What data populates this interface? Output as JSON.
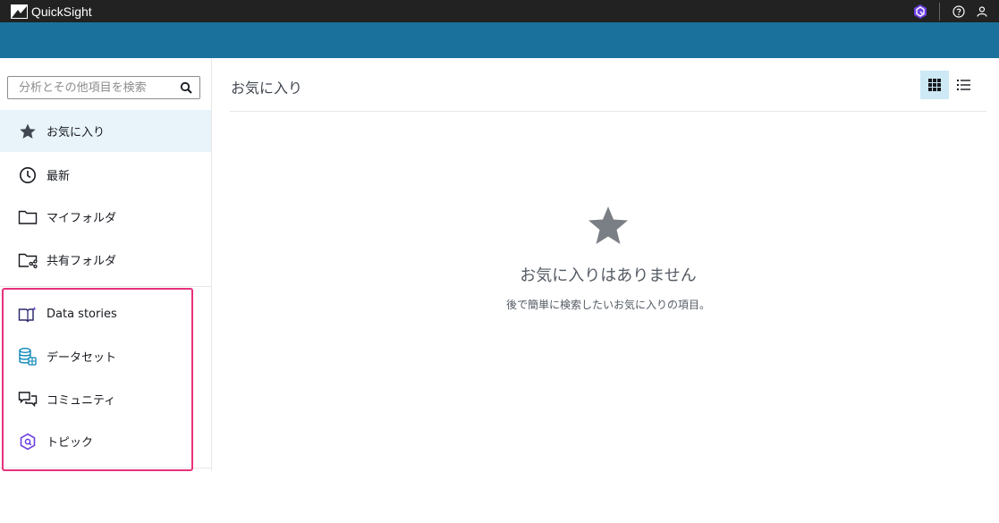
{
  "app": {
    "name": "QuickSight"
  },
  "search": {
    "placeholder": "分析とその他項目を検索"
  },
  "sidebar": {
    "items": [
      {
        "label": "お気に入り",
        "icon": "star-icon",
        "active": true
      },
      {
        "label": "最新",
        "icon": "clock-icon"
      },
      {
        "label": "マイフォルダ",
        "icon": "folder-icon"
      },
      {
        "label": "共有フォルダ",
        "icon": "shared-folder-icon"
      },
      {
        "label": "Data stories",
        "icon": "data-stories-icon"
      },
      {
        "label": "データセット",
        "icon": "dataset-icon"
      },
      {
        "label": "コミュニティ",
        "icon": "community-icon"
      },
      {
        "label": "トピック",
        "icon": "topic-icon"
      }
    ]
  },
  "main": {
    "title": "お気に入り",
    "empty_title": "お気に入りはありません",
    "empty_subtitle": "後で簡単に検索したいお気に入りの項目。"
  },
  "colors": {
    "topbar": "#222222",
    "band": "#1a729c",
    "active_bg": "#e8f4fa",
    "highlight": "#e8317c",
    "accent_purple": "#5a3fc0"
  }
}
